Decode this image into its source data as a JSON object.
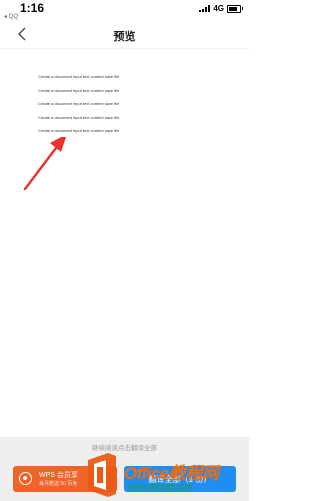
{
  "status_bar": {
    "time": "1:16",
    "back_app": "◂ QQ",
    "network": "4G",
    "battery_level": 0.8
  },
  "nav": {
    "title": "预览"
  },
  "document": {
    "lines": [
      "Create a document input text content save file",
      "Create a document input text content save file",
      "Create a document input text content save file",
      "Create a document input text content save file",
      "Create a document input text content save file"
    ]
  },
  "footer": {
    "hint": "继续阅读点击翻译全部",
    "wps_title": "WPS 会员享",
    "wps_subtitle": "每月赠送 50 页免",
    "translate_label": "翻译全部（1 份）"
  },
  "watermark": {
    "text": "Office教程网",
    "url": "www.office26.com"
  },
  "colors": {
    "accent": "#1e8ef0",
    "wps_orange": "#f0642a",
    "arrow_red": "#e8322a",
    "watermark_orange": "#ef6c10",
    "watermark_green": "#1b9e3e"
  }
}
